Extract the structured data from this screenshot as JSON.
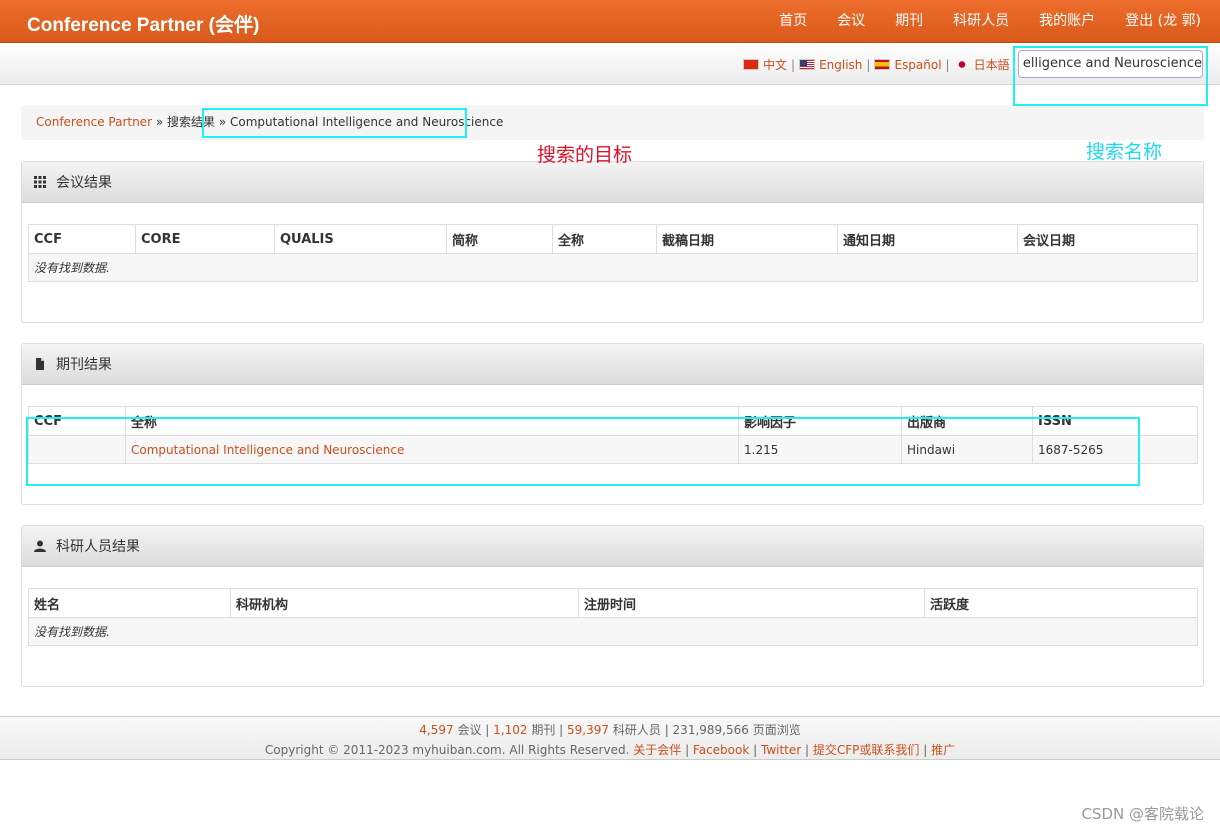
{
  "navbar": {
    "brand": "Conference Partner (会伴)",
    "items": [
      "首页",
      "会议",
      "期刊",
      "科研人员",
      "我的账户",
      "登出 (龙 郭)"
    ]
  },
  "languages": [
    "中文",
    "English",
    "Español",
    "日本語"
  ],
  "search": {
    "value": "elligence and Neuroscience"
  },
  "breadcrumb": {
    "home": "Conference Partner",
    "sep": "»",
    "level2": "搜索结果",
    "current": "Computational Intelligence and Neuroscience"
  },
  "annotations": {
    "target_label": "搜索的目标",
    "search_label": "搜索名称"
  },
  "conferences": {
    "title": "会议结果",
    "columns": [
      "CCF",
      "CORE",
      "QUALIS",
      "简称",
      "全称",
      "截稿日期",
      "通知日期",
      "会议日期"
    ],
    "empty": "没有找到数据."
  },
  "journals": {
    "title": "期刊结果",
    "columns": [
      "CCF",
      "全称",
      "影响因子",
      "出版商",
      "ISSN"
    ],
    "rows": [
      {
        "ccf": "",
        "name": "Computational Intelligence and Neuroscience",
        "impact": "1.215",
        "publisher": "Hindawi",
        "issn": "1687-5265"
      }
    ]
  },
  "researchers": {
    "title": "科研人员结果",
    "columns": [
      "姓名",
      "科研机构",
      "注册时间",
      "活跃度"
    ],
    "empty": "没有找到数据."
  },
  "footer": {
    "conf_count": "4,597",
    "conf_label": "会议",
    "journal_count": "1,102",
    "journal_label": "期刊",
    "researcher_count": "59,397",
    "researcher_label": "科研人员",
    "views": "231,989,566 页面浏览",
    "copyright": "Copyright © 2011-2023 myhuiban.com. All Rights Reserved.",
    "links": [
      "关于会伴",
      "Facebook",
      "Twitter",
      "提交CFP或联系我们",
      "推广"
    ]
  },
  "watermark": "CSDN @客院载论"
}
